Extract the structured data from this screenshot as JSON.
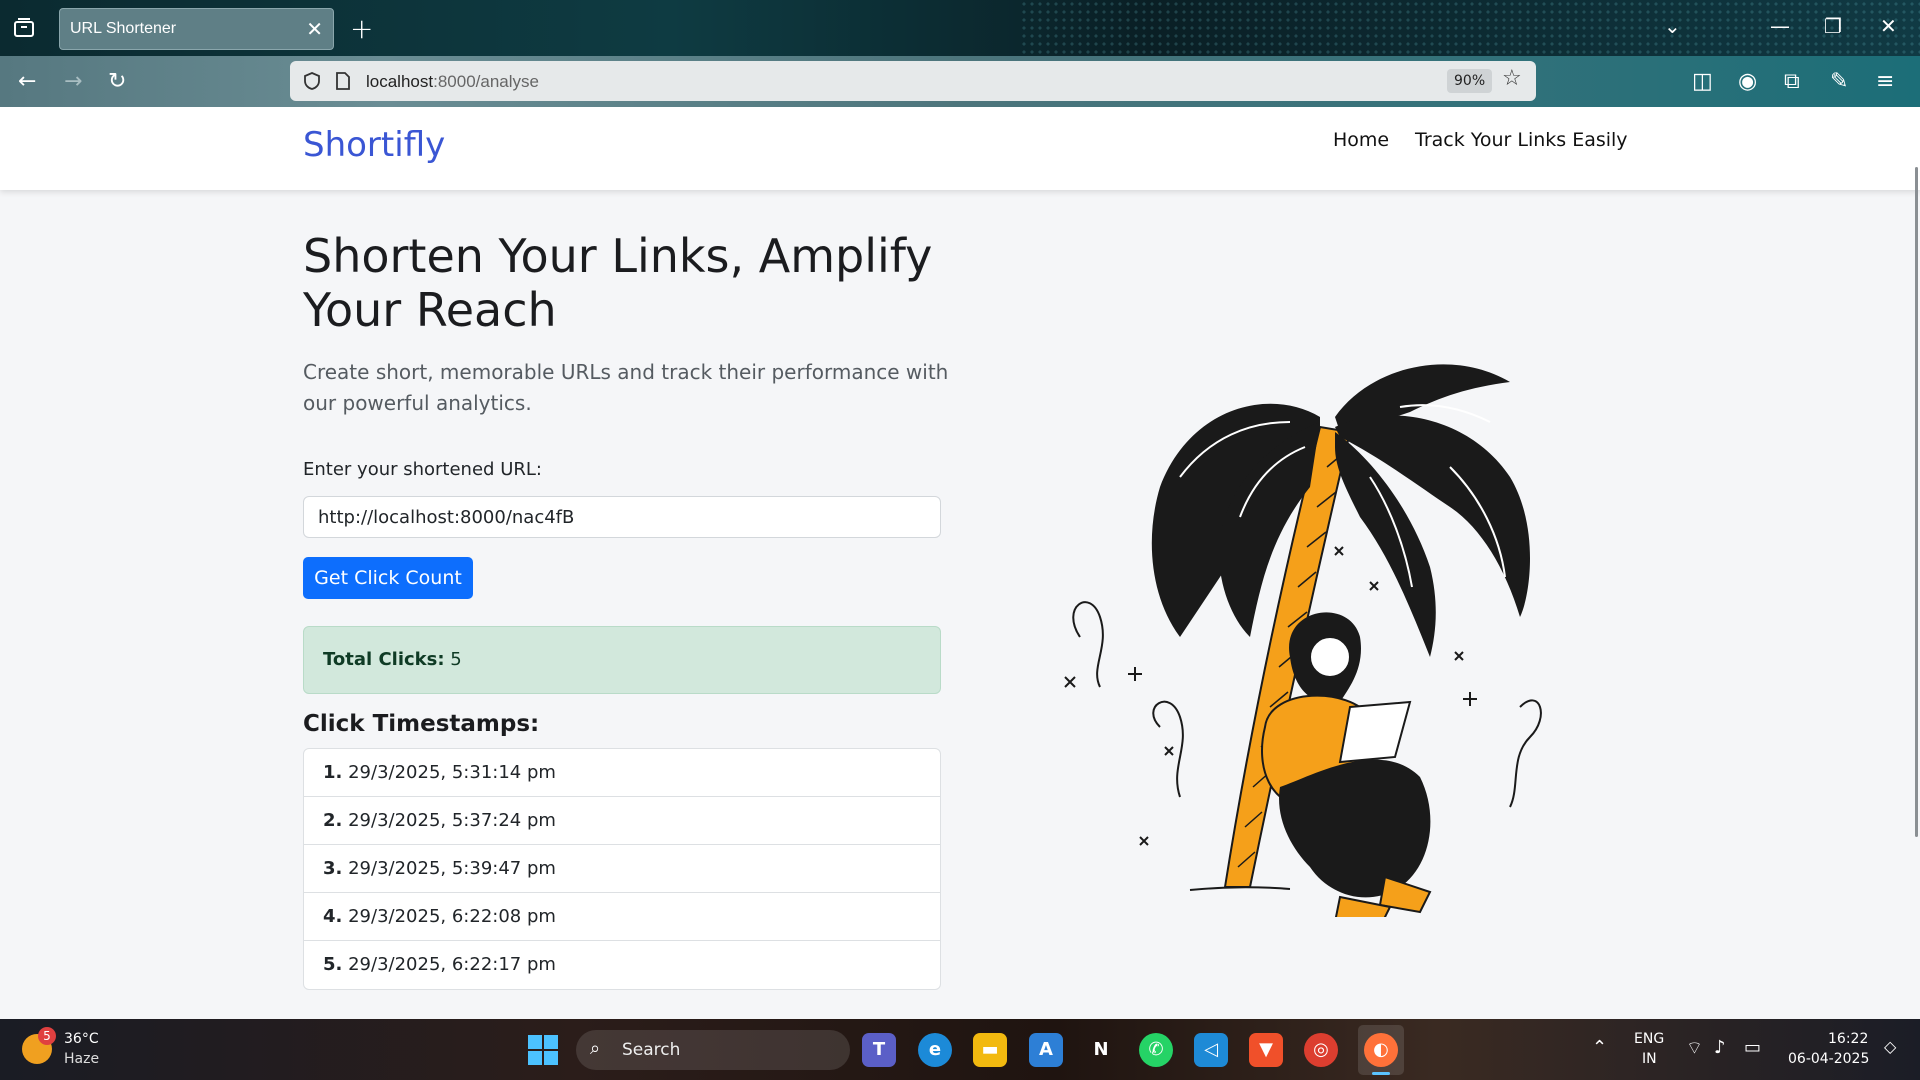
{
  "browser": {
    "tab_title": "URL Shortener",
    "url_host": "localhost",
    "url_rest": ":8000/analyse",
    "zoom": "90%"
  },
  "site": {
    "brand": "Shortifly",
    "nav": [
      "Home",
      "Track Your Links Easily"
    ]
  },
  "hero": {
    "title": "Shorten Your Links, Amplify Your Reach",
    "subtitle": "Create short, memorable URLs and track their performance with our powerful analytics."
  },
  "form": {
    "label": "Enter your shortened URL:",
    "value": "http://localhost:8000/nac4fB",
    "button": "Get Click Count"
  },
  "result": {
    "label": "Total Clicks:",
    "count": "5"
  },
  "timestamps": {
    "title": "Click Timestamps:",
    "items": [
      {
        "n": "1.",
        "t": "29/3/2025, 5:31:14 pm"
      },
      {
        "n": "2.",
        "t": "29/3/2025, 5:37:24 pm"
      },
      {
        "n": "3.",
        "t": "29/3/2025, 5:39:47 pm"
      },
      {
        "n": "4.",
        "t": "29/3/2025, 6:22:08 pm"
      },
      {
        "n": "5.",
        "t": "29/3/2025, 6:22:17 pm"
      }
    ]
  },
  "taskbar": {
    "weather_badge": "5",
    "temp": "36°C",
    "condition": "Haze",
    "search": "Search",
    "lang": "ENG",
    "region": "IN",
    "time": "16:22",
    "date": "06-04-2025"
  },
  "colors": {
    "brand": "#3a56d4",
    "primary_button": "#0d6efd",
    "result_bg": "#d2e8dc",
    "palm_trunk": "#f5a01a",
    "leaves": "#1a1a1a"
  }
}
